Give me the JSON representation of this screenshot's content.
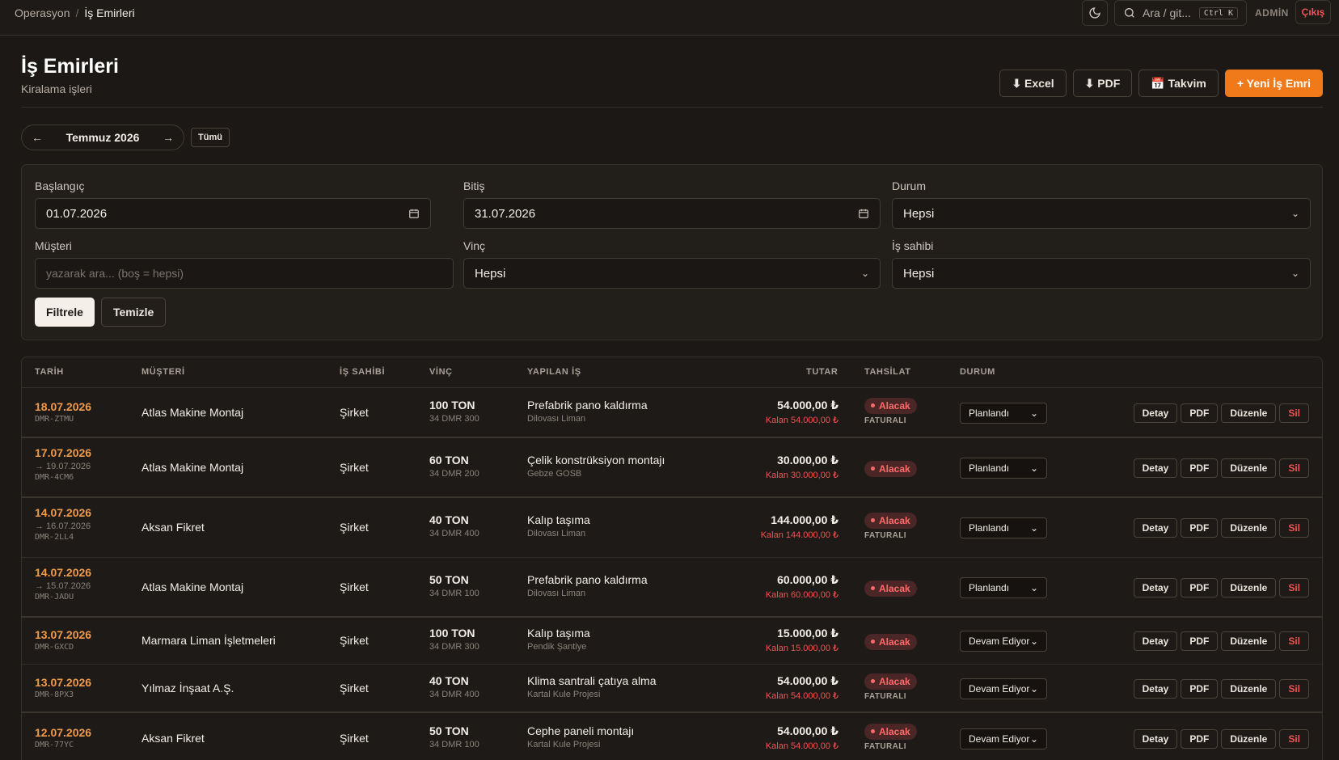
{
  "breadcrumb": {
    "parent": "Operasyon",
    "separator": "/",
    "current": "İş Emirleri"
  },
  "topbar": {
    "search_placeholder": "Ara / git...",
    "shortcut": "Ctrl K",
    "user": "ADMİN",
    "logout": "Çıkış"
  },
  "header": {
    "title": "İş Emirleri",
    "subtitle": "Kiralama işleri"
  },
  "actions": {
    "excel": "⬇ Excel",
    "pdf": "⬇ PDF",
    "calendar": "📅 Takvim",
    "new": "+ Yeni İş Emri"
  },
  "month_nav": {
    "prev": "←",
    "label": "Temmuz 2026",
    "next": "→",
    "all": "Tümü"
  },
  "filters": {
    "start_label": "Başlangıç",
    "start_value": "01.07.2026",
    "end_label": "Bitiş",
    "end_value": "31.07.2026",
    "status_label": "Durum",
    "status_value": "Hepsi",
    "customer_label": "Müşteri",
    "customer_placeholder": "yazarak ara... (boş = hepsi)",
    "crane_label": "Vinç",
    "crane_value": "Hepsi",
    "owner_label": "İş sahibi",
    "owner_value": "Hepsi",
    "apply": "Filtrele",
    "clear": "Temizle"
  },
  "table": {
    "headers": {
      "date": "TARİH",
      "customer": "MÜŞTERİ",
      "owner": "İŞ SAHİBİ",
      "crane": "VİNÇ",
      "job": "YAPILAN İŞ",
      "amount": "TUTAR",
      "collection": "TAHSİLAT",
      "status": "DURUM"
    },
    "row_buttons": {
      "detail": "Detay",
      "pdf": "PDF",
      "edit": "Düzenle",
      "delete": "Sil"
    },
    "rows": [
      {
        "date": "18.07.2026",
        "end": "",
        "code": "DMR-ZTMU",
        "customer": "Atlas Makine Montaj",
        "owner": "Şirket",
        "crane": "100 TON",
        "crane_sub": "34 DMR 300",
        "job": "Prefabrik pano kaldırma",
        "site": "Dilovası Liman",
        "amount": "54.000,00 ₺",
        "remain": "Kalan 54.000,00 ₺",
        "badge": "Alacak",
        "invoice": "FATURALI",
        "status": "Planlandı"
      },
      {
        "date": "17.07.2026",
        "end": "→ 19.07.2026",
        "code": "DMR-4CM6",
        "customer": "Atlas Makine Montaj",
        "owner": "Şirket",
        "crane": "60 TON",
        "crane_sub": "34 DMR 200",
        "job": "Çelik konstrüksiyon montajı",
        "site": "Gebze GOSB",
        "amount": "30.000,00 ₺",
        "remain": "Kalan 30.000,00 ₺",
        "badge": "Alacak",
        "invoice": "",
        "status": "Planlandı"
      },
      {
        "date": "14.07.2026",
        "end": "→ 16.07.2026",
        "code": "DMR-2LL4",
        "customer": "Aksan Fikret",
        "owner": "Şirket",
        "crane": "40 TON",
        "crane_sub": "34 DMR 400",
        "job": "Kalıp taşıma",
        "site": "Dilovası Liman",
        "amount": "144.000,00 ₺",
        "remain": "Kalan 144.000,00 ₺",
        "badge": "Alacak",
        "invoice": "FATURALI",
        "status": "Planlandı"
      },
      {
        "date": "14.07.2026",
        "end": "→ 15.07.2026",
        "code": "DMR-JADU",
        "customer": "Atlas Makine Montaj",
        "owner": "Şirket",
        "crane": "50 TON",
        "crane_sub": "34 DMR 100",
        "job": "Prefabrik pano kaldırma",
        "site": "Dilovası Liman",
        "amount": "60.000,00 ₺",
        "remain": "Kalan 60.000,00 ₺",
        "badge": "Alacak",
        "invoice": "",
        "status": "Planlandı"
      },
      {
        "date": "13.07.2026",
        "end": "",
        "code": "DMR-GXCD",
        "customer": "Marmara Liman İşletmeleri",
        "owner": "Şirket",
        "crane": "100 TON",
        "crane_sub": "34 DMR 300",
        "job": "Kalıp taşıma",
        "site": "Pendik Şantiye",
        "amount": "15.000,00 ₺",
        "remain": "Kalan 15.000,00 ₺",
        "badge": "Alacak",
        "invoice": "",
        "status": "Devam Ediyor"
      },
      {
        "date": "13.07.2026",
        "end": "",
        "code": "DMR-8PX3",
        "customer": "Yılmaz İnşaat A.Ş.",
        "owner": "Şirket",
        "crane": "40 TON",
        "crane_sub": "34 DMR 400",
        "job": "Klima santrali çatıya alma",
        "site": "Kartal Kule Projesi",
        "amount": "54.000,00 ₺",
        "remain": "Kalan 54.000,00 ₺",
        "badge": "Alacak",
        "invoice": "FATURALI",
        "status": "Devam Ediyor"
      },
      {
        "date": "12.07.2026",
        "end": "",
        "code": "DMR-77YC",
        "customer": "Aksan Fikret",
        "owner": "Şirket",
        "crane": "50 TON",
        "crane_sub": "34 DMR 100",
        "job": "Cephe paneli montajı",
        "site": "Kartal Kule Projesi",
        "amount": "54.000,00 ₺",
        "remain": "Kalan 54.000,00 ₺",
        "badge": "Alacak",
        "invoice": "FATURALI",
        "status": "Devam Ediyor"
      }
    ]
  }
}
